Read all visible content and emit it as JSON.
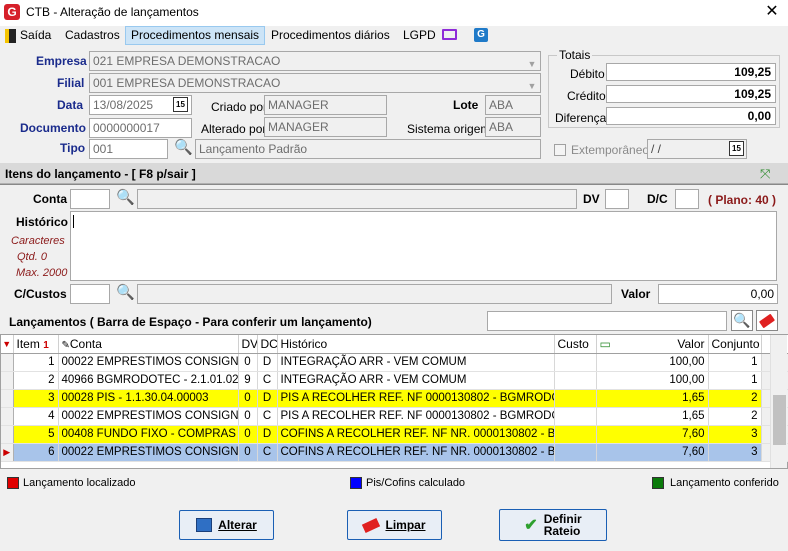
{
  "window": {
    "title": "CTB - Alteração de lançamentos",
    "logo_letter": "G",
    "close_glyph": "✕"
  },
  "menu": {
    "items": [
      "Saída",
      "Cadastros",
      "Procedimentos mensais",
      "Procedimentos diários",
      "LGPD"
    ]
  },
  "header": {
    "empresa_label": "Empresa",
    "empresa_value": "021 EMPRESA DEMONSTRACAO",
    "filial_label": "Filial",
    "filial_value": "001 EMPRESA DEMONSTRACAO",
    "data_label": "Data",
    "data_value": "13/08/2025",
    "calendar_glyph": "15",
    "criado_label": "Criado por",
    "criado_value": "MANAGER",
    "lote_label": "Lote",
    "lote_value": "ABA",
    "documento_label": "Documento",
    "documento_value": "0000000017",
    "alterado_label": "Alterado por",
    "alterado_value": "MANAGER",
    "sistema_label": "Sistema origem",
    "sistema_value": "ABA",
    "tipo_label": "Tipo",
    "tipo_code": "001",
    "tipo_desc": "Lançamento Padrão",
    "extemporaneo_label": "Extemporâneo",
    "extemporaneo_date": " /  /"
  },
  "totais": {
    "label": "Totais",
    "debito_label": "Débito",
    "debito_value": "109,25",
    "credito_label": "Crédito",
    "credito_value": "109,25",
    "diferenca_label": "Diferença",
    "diferenca_value": "0,00"
  },
  "itens": {
    "section_title": "Itens do lançamento - [ F8 p/sair ]",
    "conta_label": "Conta",
    "dv_label": "DV",
    "dc_label": "D/C",
    "plano_text": "( Plano: 40 )",
    "historico_label": "Histórico",
    "caracteres_label": "Caracteres",
    "qtd_label": "Qtd. 0",
    "max_label": "Max. 2000",
    "ccustos_label": "C/Custos",
    "valor_label": "Valor",
    "valor_value": "0,00"
  },
  "lancamentos": {
    "title": "Lançamentos ( Barra de Espaço - Para conferir um lançamento)",
    "columns": [
      "Item",
      "Conta",
      "DV",
      "DC",
      "Histórico",
      "Custo",
      "Valor",
      "Conjunto"
    ],
    "rows": [
      {
        "item": "1",
        "conta": "00022 EMPRESTIMOS CONSIGN...",
        "dv": "0",
        "dc": "D",
        "historico": "INTEGRAÇÃO ARR - VEM COMUM",
        "custo": "",
        "valor": "100,00",
        "conjunto": "1",
        "style": "normal"
      },
      {
        "item": "2",
        "conta": "40966 BGMRODOTEC - 2.1.01.02...",
        "dv": "9",
        "dc": "C",
        "historico": "INTEGRAÇÃO ARR - VEM COMUM",
        "custo": "",
        "valor": "100,00",
        "conjunto": "1",
        "style": "normal"
      },
      {
        "item": "3",
        "conta": "00028 PIS - 1.1.30.04.00003",
        "dv": "0",
        "dc": "D",
        "historico": "PIS A RECOLHER REF. NF 0000130802 - BGMRODO...",
        "custo": "",
        "valor": "1,65",
        "conjunto": "2",
        "style": "yellow"
      },
      {
        "item": "4",
        "conta": "00022 EMPRESTIMOS CONSIGN...",
        "dv": "0",
        "dc": "C",
        "historico": "PIS A RECOLHER REF. NF 0000130802 - BGMRODO...",
        "custo": "",
        "valor": "1,65",
        "conjunto": "2",
        "style": "normal"
      },
      {
        "item": "5",
        "conta": "00408 FUNDO FIXO - COMPRAS - ...",
        "dv": "0",
        "dc": "D",
        "historico": "COFINS A RECOLHER REF. NF NR. 0000130802 - B...",
        "custo": "",
        "valor": "7,60",
        "conjunto": "3",
        "style": "yellow"
      },
      {
        "item": "6",
        "conta": "00022 EMPRESTIMOS CONSIGN...",
        "dv": "0",
        "dc": "C",
        "historico": "COFINS A RECOLHER REF. NF NR. 0000130802 - B...",
        "custo": "",
        "valor": "7,60",
        "conjunto": "3",
        "style": "sel"
      }
    ]
  },
  "legend": {
    "localizado": "Lançamento localizado",
    "localizado_color": "#e00000",
    "pis": "Pis/Cofins calculado",
    "pis_color": "#0000ff",
    "conferido": "Lançamento conferido",
    "conferido_color": "#0a7a0a"
  },
  "buttons": {
    "alterar": "Alterar",
    "limpar": "Limpar",
    "definir_1": "Definir",
    "definir_2": "Rateio"
  }
}
